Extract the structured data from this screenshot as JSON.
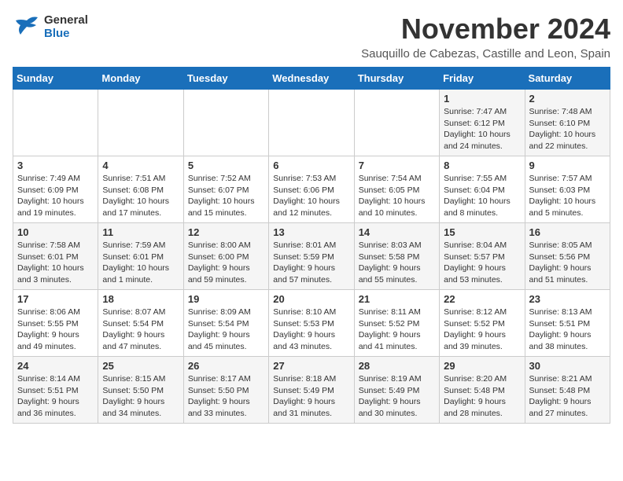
{
  "logo": {
    "line1": "General",
    "line2": "Blue"
  },
  "title": "November 2024",
  "location": "Sauquillo de Cabezas, Castille and Leon, Spain",
  "days_of_week": [
    "Sunday",
    "Monday",
    "Tuesday",
    "Wednesday",
    "Thursday",
    "Friday",
    "Saturday"
  ],
  "weeks": [
    [
      {
        "day": "",
        "info": ""
      },
      {
        "day": "",
        "info": ""
      },
      {
        "day": "",
        "info": ""
      },
      {
        "day": "",
        "info": ""
      },
      {
        "day": "",
        "info": ""
      },
      {
        "day": "1",
        "info": "Sunrise: 7:47 AM\nSunset: 6:12 PM\nDaylight: 10 hours and 24 minutes."
      },
      {
        "day": "2",
        "info": "Sunrise: 7:48 AM\nSunset: 6:10 PM\nDaylight: 10 hours and 22 minutes."
      }
    ],
    [
      {
        "day": "3",
        "info": "Sunrise: 7:49 AM\nSunset: 6:09 PM\nDaylight: 10 hours and 19 minutes."
      },
      {
        "day": "4",
        "info": "Sunrise: 7:51 AM\nSunset: 6:08 PM\nDaylight: 10 hours and 17 minutes."
      },
      {
        "day": "5",
        "info": "Sunrise: 7:52 AM\nSunset: 6:07 PM\nDaylight: 10 hours and 15 minutes."
      },
      {
        "day": "6",
        "info": "Sunrise: 7:53 AM\nSunset: 6:06 PM\nDaylight: 10 hours and 12 minutes."
      },
      {
        "day": "7",
        "info": "Sunrise: 7:54 AM\nSunset: 6:05 PM\nDaylight: 10 hours and 10 minutes."
      },
      {
        "day": "8",
        "info": "Sunrise: 7:55 AM\nSunset: 6:04 PM\nDaylight: 10 hours and 8 minutes."
      },
      {
        "day": "9",
        "info": "Sunrise: 7:57 AM\nSunset: 6:03 PM\nDaylight: 10 hours and 5 minutes."
      }
    ],
    [
      {
        "day": "10",
        "info": "Sunrise: 7:58 AM\nSunset: 6:01 PM\nDaylight: 10 hours and 3 minutes."
      },
      {
        "day": "11",
        "info": "Sunrise: 7:59 AM\nSunset: 6:01 PM\nDaylight: 10 hours and 1 minute."
      },
      {
        "day": "12",
        "info": "Sunrise: 8:00 AM\nSunset: 6:00 PM\nDaylight: 9 hours and 59 minutes."
      },
      {
        "day": "13",
        "info": "Sunrise: 8:01 AM\nSunset: 5:59 PM\nDaylight: 9 hours and 57 minutes."
      },
      {
        "day": "14",
        "info": "Sunrise: 8:03 AM\nSunset: 5:58 PM\nDaylight: 9 hours and 55 minutes."
      },
      {
        "day": "15",
        "info": "Sunrise: 8:04 AM\nSunset: 5:57 PM\nDaylight: 9 hours and 53 minutes."
      },
      {
        "day": "16",
        "info": "Sunrise: 8:05 AM\nSunset: 5:56 PM\nDaylight: 9 hours and 51 minutes."
      }
    ],
    [
      {
        "day": "17",
        "info": "Sunrise: 8:06 AM\nSunset: 5:55 PM\nDaylight: 9 hours and 49 minutes."
      },
      {
        "day": "18",
        "info": "Sunrise: 8:07 AM\nSunset: 5:54 PM\nDaylight: 9 hours and 47 minutes."
      },
      {
        "day": "19",
        "info": "Sunrise: 8:09 AM\nSunset: 5:54 PM\nDaylight: 9 hours and 45 minutes."
      },
      {
        "day": "20",
        "info": "Sunrise: 8:10 AM\nSunset: 5:53 PM\nDaylight: 9 hours and 43 minutes."
      },
      {
        "day": "21",
        "info": "Sunrise: 8:11 AM\nSunset: 5:52 PM\nDaylight: 9 hours and 41 minutes."
      },
      {
        "day": "22",
        "info": "Sunrise: 8:12 AM\nSunset: 5:52 PM\nDaylight: 9 hours and 39 minutes."
      },
      {
        "day": "23",
        "info": "Sunrise: 8:13 AM\nSunset: 5:51 PM\nDaylight: 9 hours and 38 minutes."
      }
    ],
    [
      {
        "day": "24",
        "info": "Sunrise: 8:14 AM\nSunset: 5:51 PM\nDaylight: 9 hours and 36 minutes."
      },
      {
        "day": "25",
        "info": "Sunrise: 8:15 AM\nSunset: 5:50 PM\nDaylight: 9 hours and 34 minutes."
      },
      {
        "day": "26",
        "info": "Sunrise: 8:17 AM\nSunset: 5:50 PM\nDaylight: 9 hours and 33 minutes."
      },
      {
        "day": "27",
        "info": "Sunrise: 8:18 AM\nSunset: 5:49 PM\nDaylight: 9 hours and 31 minutes."
      },
      {
        "day": "28",
        "info": "Sunrise: 8:19 AM\nSunset: 5:49 PM\nDaylight: 9 hours and 30 minutes."
      },
      {
        "day": "29",
        "info": "Sunrise: 8:20 AM\nSunset: 5:48 PM\nDaylight: 9 hours and 28 minutes."
      },
      {
        "day": "30",
        "info": "Sunrise: 8:21 AM\nSunset: 5:48 PM\nDaylight: 9 hours and 27 minutes."
      }
    ]
  ]
}
